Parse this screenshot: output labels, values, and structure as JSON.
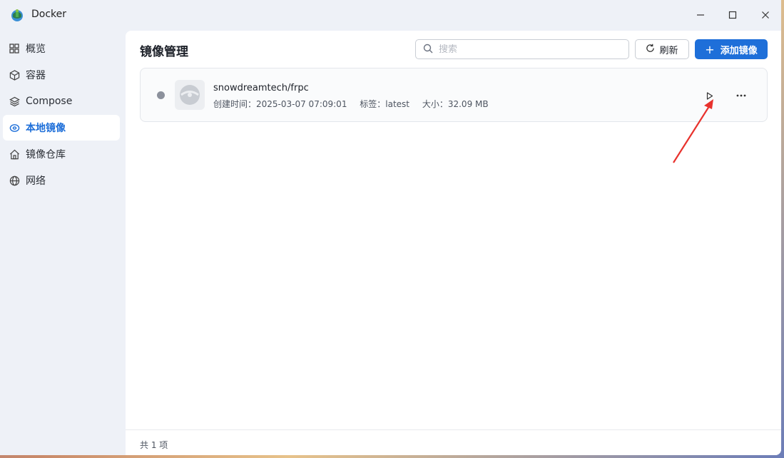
{
  "app": {
    "title": "Docker"
  },
  "window_controls": {
    "minimize": "minimize-icon",
    "maximize": "maximize-icon",
    "close": "close-icon"
  },
  "sidebar": {
    "items": [
      {
        "label": "概览",
        "icon": "grid-icon",
        "active": false
      },
      {
        "label": "容器",
        "icon": "cube-icon",
        "active": false
      },
      {
        "label": "Compose",
        "icon": "layers-icon",
        "active": false
      },
      {
        "label": "本地镜像",
        "icon": "disc-icon",
        "active": true
      },
      {
        "label": "镜像仓库",
        "icon": "home-icon",
        "active": false
      },
      {
        "label": "网络",
        "icon": "globe-icon",
        "active": false
      }
    ]
  },
  "main": {
    "title": "镜像管理",
    "search": {
      "placeholder": "搜索",
      "value": ""
    },
    "refresh_label": "刷新",
    "add_label": "添加镜像",
    "images": [
      {
        "name": "snowdreamtech/frpc",
        "created": "创建时间：2025-03-07 07:09:01",
        "tag": "标签：latest",
        "size": "大小：32.09 MB",
        "status_color": "#8c919c"
      }
    ],
    "footer": "共 1 项"
  },
  "colors": {
    "accent": "#1e6fd9",
    "annotation": "#e8322d"
  }
}
